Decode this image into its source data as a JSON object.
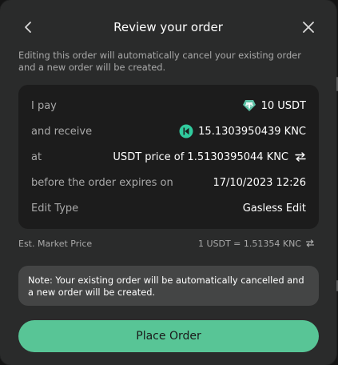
{
  "header": {
    "title": "Review your order",
    "back_icon": "chevron-left-icon",
    "close_icon": "close-icon"
  },
  "warning": "Editing this order will automatically cancel your existing order and a new order will be created.",
  "summary": {
    "pay": {
      "label": "I pay",
      "value": "10 USDT",
      "token_icon": "usdt-token-icon",
      "icon_color": "#5dc2a6"
    },
    "receive": {
      "label": "and receive",
      "value": "15.1303950439 KNC",
      "token_icon": "knc-token-icon",
      "icon_color": "#31cb9e"
    },
    "rate": {
      "label": "at",
      "value": "USDT price of 1.5130395044 KNC",
      "swap_icon": "swap-arrows-icon"
    },
    "expiry": {
      "label": "before the order expires on",
      "value": "17/10/2023 12:26"
    },
    "edit_type": {
      "label": "Edit Type",
      "value": "Gasless Edit"
    }
  },
  "market": {
    "label": "Est. Market Price",
    "value": "1 USDT = 1.51354 KNC",
    "refresh_icon": "refresh-icon"
  },
  "note": "Note: Your existing order will be automatically cancelled and a new order will be created.",
  "actions": {
    "place_order": "Place Order"
  },
  "colors": {
    "accent": "#58c596",
    "modal_bg": "#2a2b2b",
    "card_bg": "#1c1c1c",
    "note_bg": "#444545"
  }
}
